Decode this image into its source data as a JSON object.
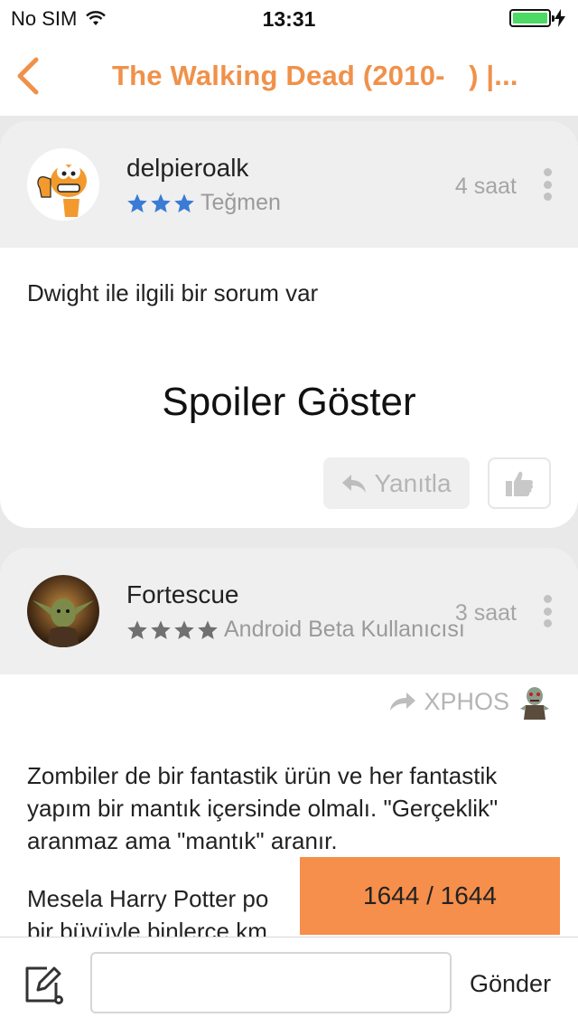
{
  "status_bar": {
    "carrier": "No SIM",
    "time": "13:31",
    "battery_level": 1.0,
    "battery_color": "#4cd964"
  },
  "nav": {
    "back_icon": "chevron-left-icon",
    "title": "The Walking Dead (2010-   ) |..."
  },
  "comments": [
    {
      "username": "delpieroalk",
      "rating_stars": 3,
      "star_color": "#3a7bd5",
      "rank": "Teğmen",
      "time": "4 saat",
      "text": "Dwight ile ilgili bir sorum var",
      "spoiler_label": "Spoiler Göster",
      "reply_label": "Yanıtla"
    },
    {
      "username": "Fortescue",
      "rating_stars": 4,
      "star_color": "#707070",
      "rank": "Android Beta Kullanıcısı",
      "time": "3 saat",
      "reply_to": "XPHOS",
      "paragraphs": [
        "Zombiler de bir fantastik ürün ve her fantastik yapım bir mantık içersinde olmalı. \"Gerçeklik\" aranmaz ama \"mantık\" aranır.",
        "Mesela Harry Potter po",
        "bir büyüyle binlerce km"
      ]
    }
  ],
  "counter": "1644 / 1644",
  "counter_color": "#f68f4b",
  "composer": {
    "input_value": "",
    "send_label": "Gönder"
  },
  "accent_color": "#f0914a"
}
